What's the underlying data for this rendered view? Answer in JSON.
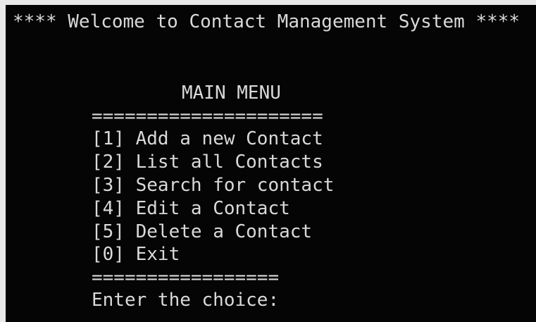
{
  "console": {
    "title_line": "**** Welcome to Contact Management System ****",
    "menu_heading": "MAIN MENU",
    "rule_top": "=====================",
    "menu_items": [
      {
        "key": "[1]",
        "label": "Add a new Contact"
      },
      {
        "key": "[2]",
        "label": "List all Contacts"
      },
      {
        "key": "[3]",
        "label": "Search for contact"
      },
      {
        "key": "[4]",
        "label": "Edit a Contact"
      },
      {
        "key": "[5]",
        "label": "Delete a Contact"
      },
      {
        "key": "[0]",
        "label": "Exit"
      }
    ],
    "rule_bottom": "=================",
    "prompt": "Enter the choice:",
    "input_value": ""
  },
  "colors": {
    "background": "#050505",
    "text": "#d9d9d9",
    "frame": "#e9e9e9"
  }
}
